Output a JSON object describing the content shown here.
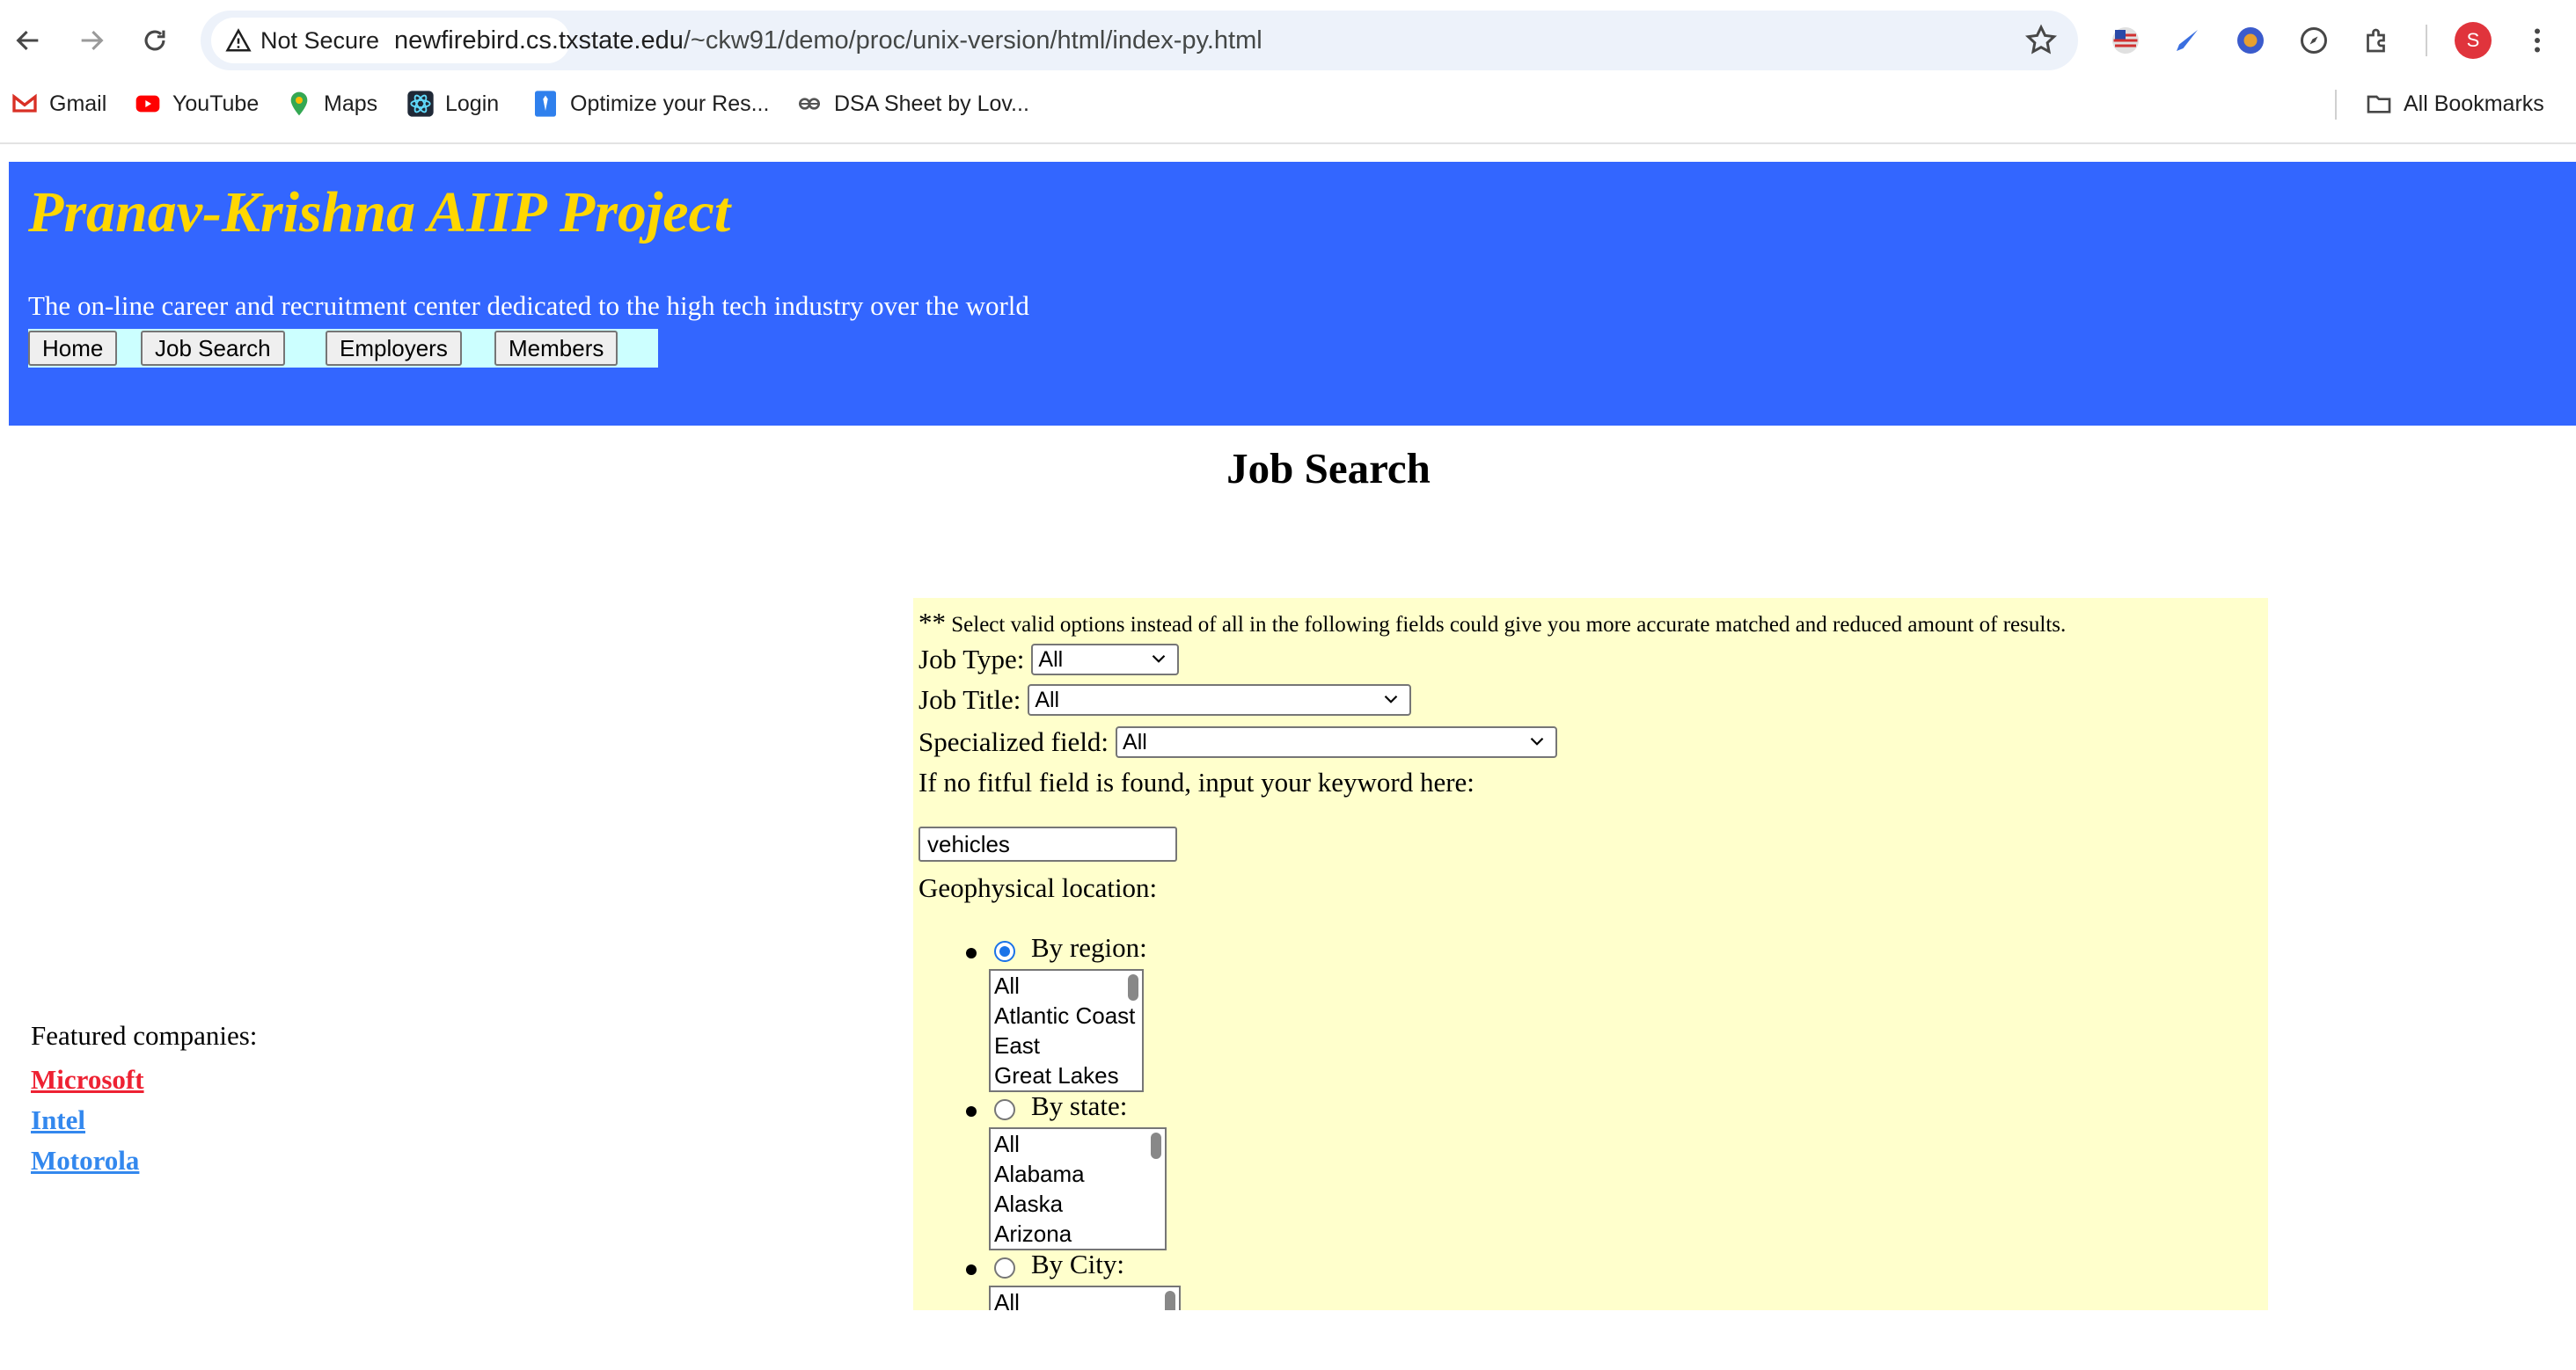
{
  "browser": {
    "security_label": "Not Secure",
    "url_host": "newfirebird.cs.txstate.edu",
    "url_path": "/~ckw91/demo/proc/unix-version/html/index-py.html",
    "profile_initial": "S",
    "bookmarks": [
      {
        "label": "Gmail",
        "icon": "gmail-icon"
      },
      {
        "label": "YouTube",
        "icon": "youtube-icon"
      },
      {
        "label": "Maps",
        "icon": "maps-icon"
      },
      {
        "label": "Login",
        "icon": "react-icon"
      },
      {
        "label": "Optimize your Res...",
        "icon": "tie-icon"
      },
      {
        "label": "DSA Sheet by Lov...",
        "icon": "link-icon"
      }
    ],
    "all_bookmarks_label": "All Bookmarks"
  },
  "site": {
    "title": "Pranav-Krishna AIIP Project",
    "tagline": "The on-line career and recruitment center dedicated to the high tech industry over the world",
    "nav": [
      "Home",
      "Job Search",
      "Employers",
      "Members"
    ],
    "colors": {
      "header_bg": "#3366ff",
      "title": "#ffd700",
      "nav_bg": "#ccffff",
      "panel_bg": "#ffffcc"
    }
  },
  "page": {
    "heading": "Job Search"
  },
  "featured": {
    "label": "Featured companies:",
    "companies": [
      "Microsoft",
      "Intel",
      "Motorola"
    ]
  },
  "search": {
    "note_stars": "**",
    "note": "Select valid options instead of all in the following fields could give you more accurate matched and reduced amount of results.",
    "job_type_label": "Job Type:",
    "job_type_value": "All",
    "job_title_label": "Job Title:",
    "job_title_value": "All",
    "specialized_label": "Specialized field:",
    "specialized_value": "All",
    "keyword_label": "If no fitful field is found, input your keyword here:",
    "keyword_value": "vehicles",
    "geo_label": "Geophysical location:",
    "by_region_label": "By region:",
    "regions": [
      "All",
      "Atlantic Coast",
      "East",
      "Great Lakes"
    ],
    "by_state_label": "By state:",
    "states": [
      "All",
      "Alabama",
      "Alaska",
      "Arizona"
    ],
    "by_city_label": "By City:",
    "cities": [
      "All"
    ],
    "selected_geo": "region"
  }
}
